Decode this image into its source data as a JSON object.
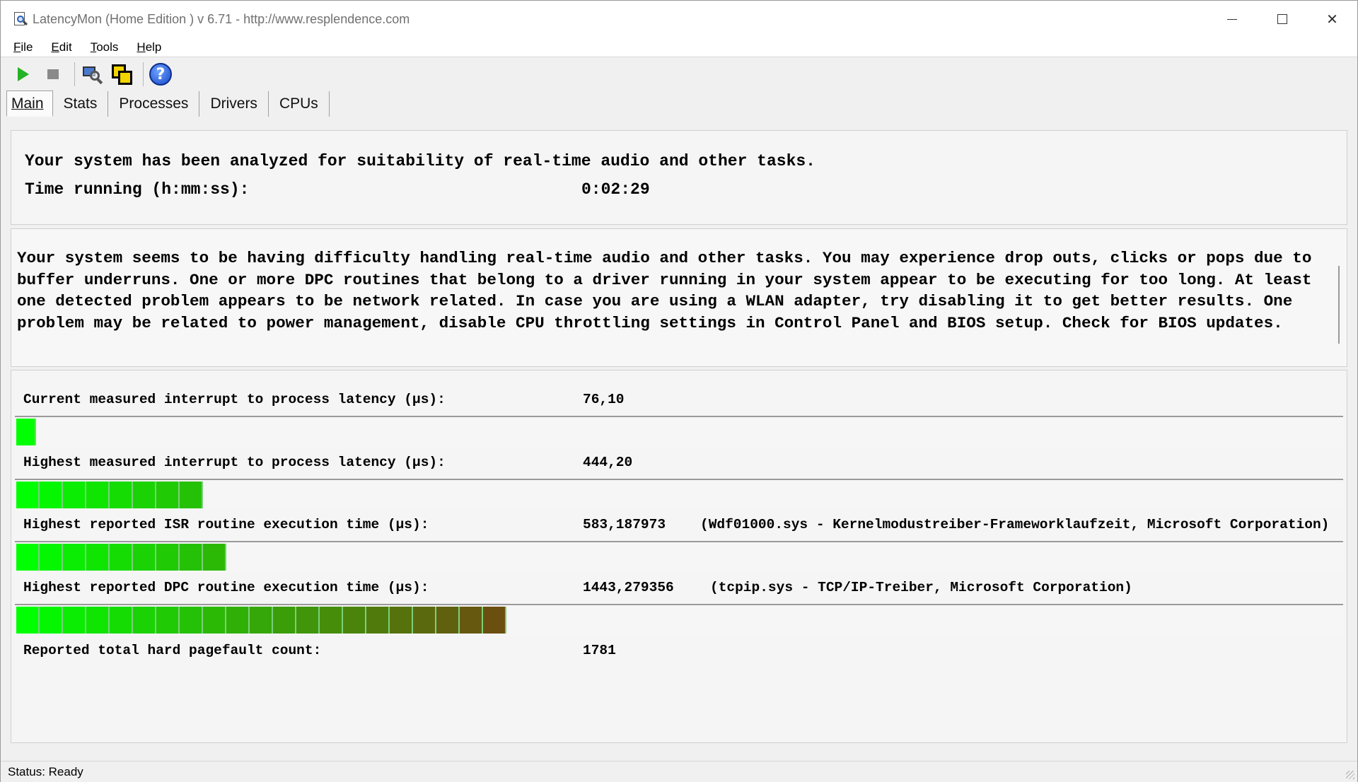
{
  "window": {
    "title": "LatencyMon  (Home Edition )  v 6.71 - http://www.resplendence.com"
  },
  "menu": {
    "items": [
      {
        "first": "F",
        "rest": "ile"
      },
      {
        "first": "E",
        "rest": "dit"
      },
      {
        "first": "T",
        "rest": "ools"
      },
      {
        "first": "H",
        "rest": "elp"
      }
    ]
  },
  "toolbar": {
    "icons": [
      "play-icon",
      "stop-icon",
      "monitor-icon",
      "copy-icon",
      "help-icon"
    ],
    "help_glyph": "?"
  },
  "tabs": [
    {
      "label": "Main",
      "active": true
    },
    {
      "label": "Stats",
      "active": false
    },
    {
      "label": "Processes",
      "active": false
    },
    {
      "label": "Drivers",
      "active": false
    },
    {
      "label": "CPUs",
      "active": false
    }
  ],
  "summary": {
    "analyzed": "Your system has been analyzed for suitability of real-time audio and other tasks.",
    "time_label": "Time running (h:mm:ss):",
    "time_value": "0:02:29"
  },
  "message": "Your system seems to be having difficulty handling real-time audio and other tasks. You may experience drop outs, clicks or pops due to buffer underruns. One or more DPC routines that belong to a driver running in your system appear to be executing for too long. At least one detected problem appears to be network related. In case you are using a WLAN adapter, try disabling it to get better results. One problem may be related to power management, disable CPU throttling settings in Control Panel and BIOS setup. Check for BIOS updates.",
  "metrics": [
    {
      "label": "Current measured interrupt to process latency (µs):",
      "value": "76,10",
      "extra": "",
      "bar_segments": 1
    },
    {
      "label": "Highest measured interrupt to process latency (µs):",
      "value": "444,20",
      "extra": "",
      "bar_segments": 8
    },
    {
      "label": "Highest reported ISR routine execution time (µs):",
      "value": "583,187973",
      "extra": "(Wdf01000.sys - Kernelmodustreiber-Frameworklaufzeit, Microsoft Corporation)",
      "bar_segments": 9
    },
    {
      "label": "Highest reported DPC routine execution time (µs):",
      "value": "1443,279356",
      "extra": "(tcpip.sys - TCP/IP-Treiber, Microsoft Corporation)",
      "bar_segments": 21
    },
    {
      "label": "Reported total hard pagefault count:",
      "value": "1781",
      "extra": "",
      "bar_segments": 0
    }
  ],
  "colors": {
    "bar_start": "#00ff00",
    "bar_end": "#6b4f10"
  },
  "status": {
    "text": "Status: Ready"
  }
}
